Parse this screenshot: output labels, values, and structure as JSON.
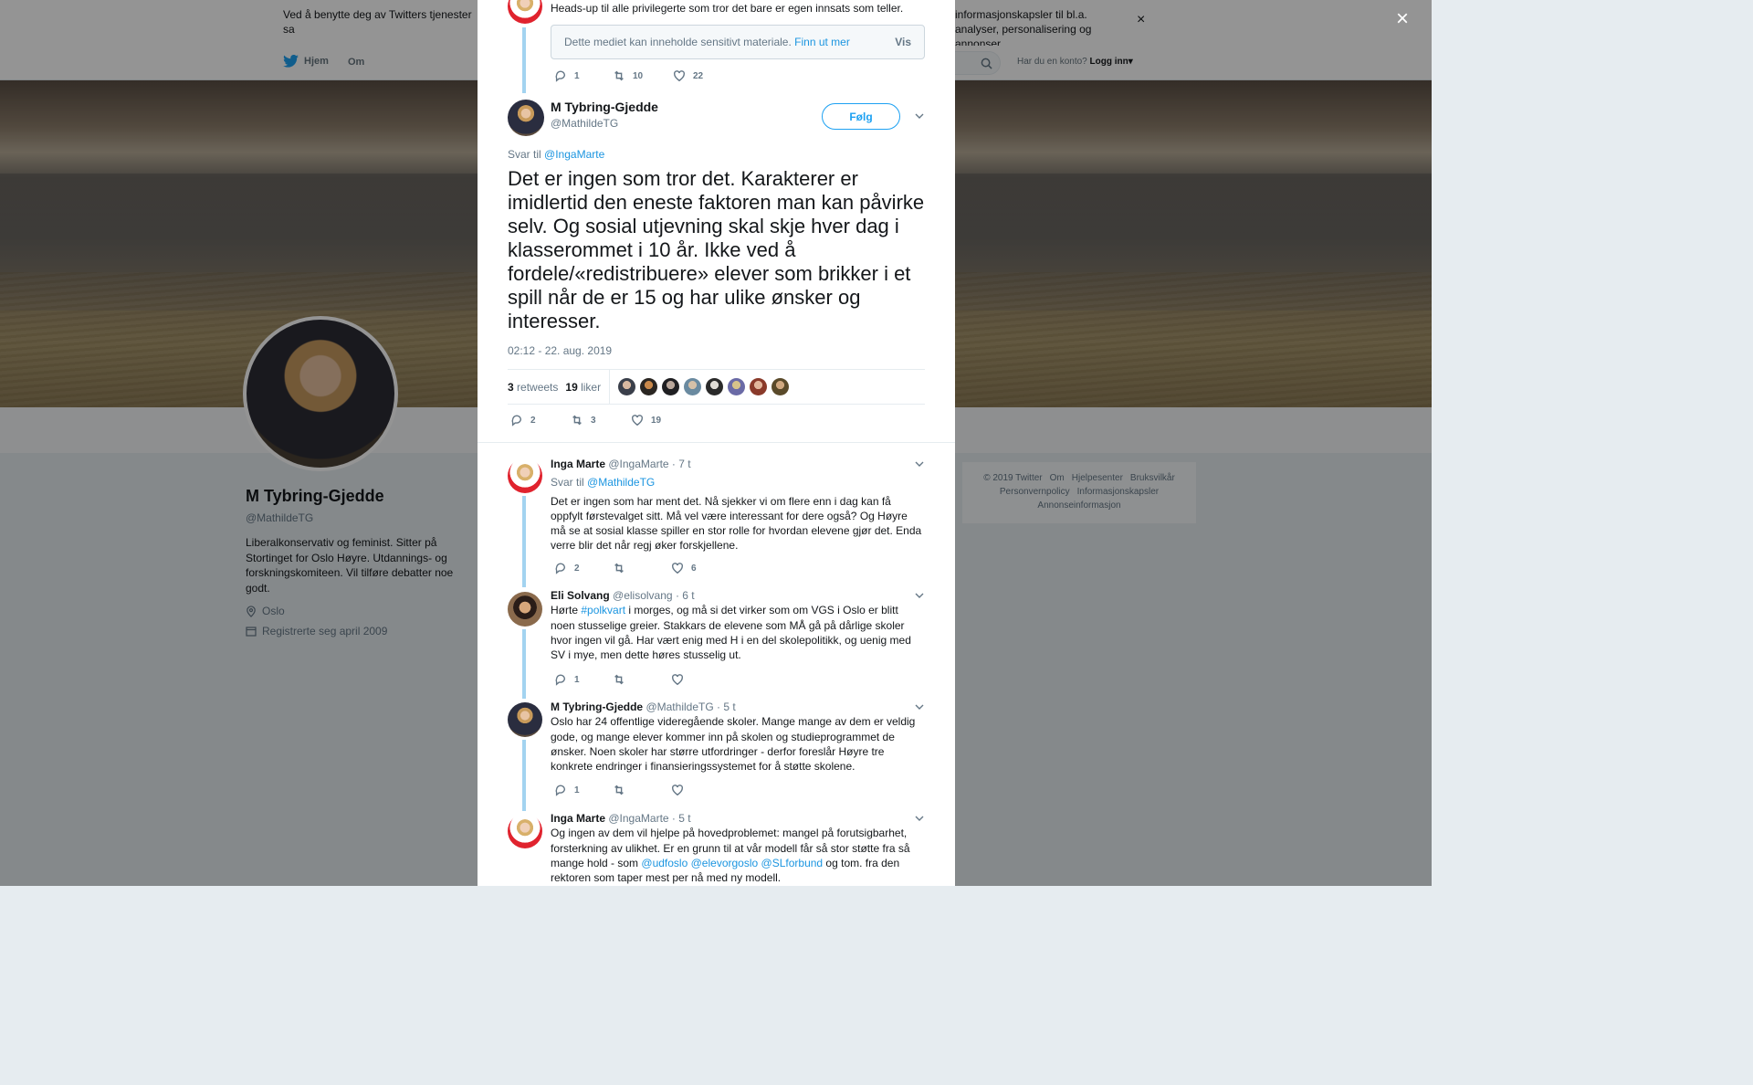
{
  "cookie_bar": {
    "left_text": "Ved å benytte deg av Twitters tjenester sa",
    "right_text": "informasjonskapsler til bl.a. analyser, personalisering og annonser.",
    "close": "×"
  },
  "nav": {
    "home": "Hjem",
    "about": "Om",
    "login_prompt": "Har du en konto?",
    "login": "Logg inn"
  },
  "profile": {
    "name": "M Tybring-Gjedde",
    "handle": "@MathildeTG",
    "bio": "Liberalkonservativ og feminist. Sitter på Stortinget for Oslo Høyre. Utdannings- og forskningskomiteen. Vil tilføre debatter noe godt.",
    "location": "Oslo",
    "joined": "Registrerte seg april 2009"
  },
  "footer": {
    "links": [
      "© 2019 Twitter",
      "Om",
      "Hjelpesenter",
      "Bruksvilkår",
      "Personvernpolicy",
      "Informasjonskapsler",
      "Annonseinformasjon"
    ]
  },
  "overlay_close": "×",
  "prev_tweet": {
    "text": "Heads-up til alle privilegerte som tror det bare er egen innsats som teller.",
    "sensitive_text": "Dette mediet kan inneholde sensitivt materiale.",
    "sensitive_link": "Finn ut mer",
    "sensitive_show": "Vis",
    "replies": "1",
    "retweets": "10",
    "likes": "22"
  },
  "main_tweet": {
    "name": "M Tybring-Gjedde",
    "handle": "@MathildeTG",
    "follow": "Følg",
    "reply_prefix": "Svar til",
    "reply_to": "@IngaMarte",
    "text": "Det er ingen som tror det. Karakterer er imidlertid den eneste faktoren man kan påvirke selv. Og sosial utjevning skal skje hver dag i klasserommet i 10 år. Ikke ved å fordele/«redistribuere» elever som brikker i et spill når de er 15 og har ulike ønsker og interesser.",
    "time": "02:12 - 22. aug. 2019",
    "retweet_count": "3",
    "retweet_label": "retweets",
    "like_count": "19",
    "like_label": "liker",
    "replies": "2",
    "retweets": "3",
    "likes": "19"
  },
  "replies": [
    {
      "name": "Inga Marte",
      "handle": "@IngaMarte",
      "time": "· 7 t",
      "reply_prefix": "Svar til",
      "reply_to": "@MathildeTG",
      "text": "Det er ingen som har ment det. Nå sjekker vi om flere enn i dag kan få oppfylt førstevalget sitt. Må vel være interessant for dere også? Og Høyre må se at sosial klasse spiller en stor rolle for hvordan elevene gjør det. Enda verre blir det når regj øker forskjellene.",
      "replies": "2",
      "retweets": "",
      "likes": "6"
    },
    {
      "name": "Eli Solvang",
      "handle": "@elisolvang",
      "time": "· 6 t",
      "text_a": "Hørte ",
      "hashtag": "#polkvart",
      "text_b": " i morges, og må si det virker som om VGS i Oslo er blitt noen stusselige greier. Stakkars de elevene som MÅ gå på dårlige skoler hvor ingen vil gå. Har vært enig med H i en del skolepolitikk, og uenig med SV i mye, men dette høres stusselig ut.",
      "replies": "1",
      "retweets": "",
      "likes": ""
    },
    {
      "name": "M Tybring-Gjedde",
      "handle": "@MathildeTG",
      "time": "· 5 t",
      "text": "Oslo har 24 offentlige videregående skoler. Mange mange av dem er veldig gode, og mange elever kommer inn på skolen og studieprogrammet de ønsker. Noen skoler har større utfordringer - derfor foreslår Høyre tre konkrete endringer i finansieringssystemet for å støtte skolene.",
      "replies": "1",
      "retweets": "",
      "likes": ""
    },
    {
      "name": "Inga Marte",
      "handle": "@IngaMarte",
      "time": "· 5 t",
      "text_a": "Og ingen av dem vil hjelpe på hovedproblemet: mangel på forutsigbarhet, forsterkning av ulikhet. Er en grunn til at vår modell får så stor støtte fra så mange hold - som ",
      "mention1": "@udfoslo",
      "mention2": "@elevorgoslo",
      "mention3": "@SLforbund",
      "text_b": " og tom. fra den rektoren som taper mest per nå med ny modell."
    }
  ],
  "colors": {
    "accent": "#1da1f2",
    "link": "#1b95e0",
    "thread_line": "#a3d3f0"
  }
}
